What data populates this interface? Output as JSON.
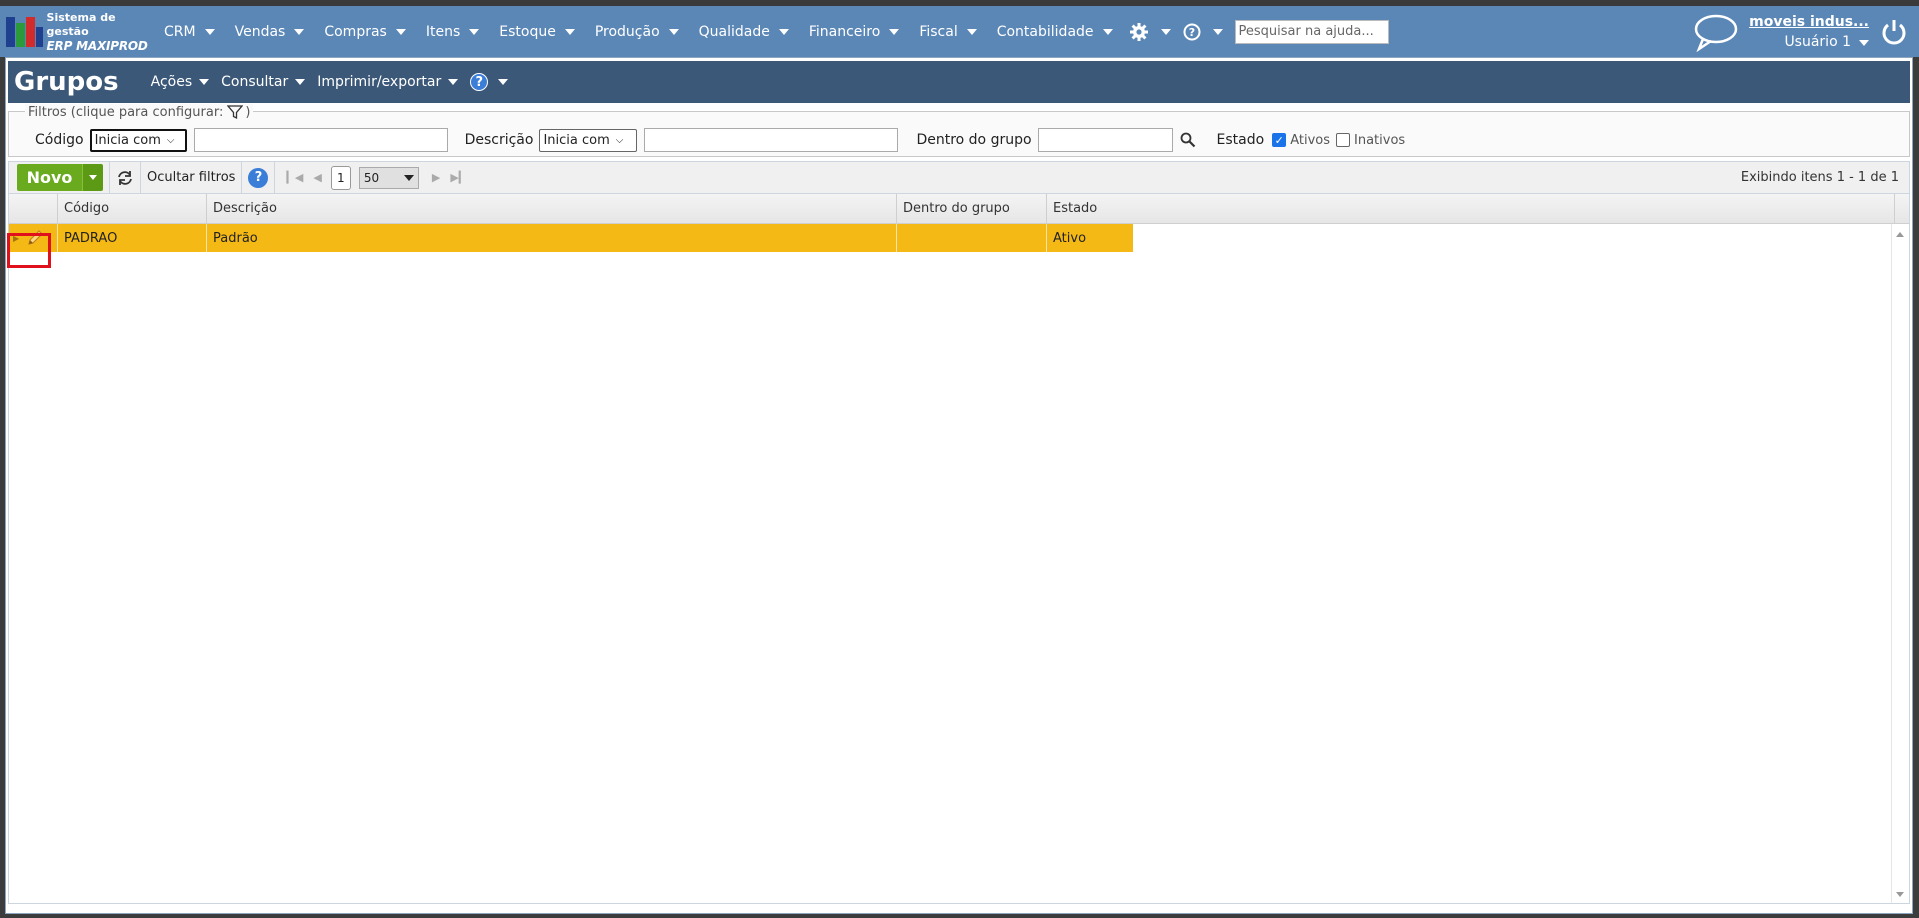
{
  "app": {
    "logo_line1": "Sistema de gestão",
    "logo_line2": "ERP MAXIPROD",
    "accent": "#5b87b7"
  },
  "nav": {
    "items": [
      {
        "label": "CRM"
      },
      {
        "label": "Vendas"
      },
      {
        "label": "Compras"
      },
      {
        "label": "Itens"
      },
      {
        "label": "Estoque"
      },
      {
        "label": "Produção"
      },
      {
        "label": "Qualidade"
      },
      {
        "label": "Financeiro"
      },
      {
        "label": "Fiscal"
      },
      {
        "label": "Contabilidade"
      }
    ],
    "help_search_placeholder": "Pesquisar na ajuda...",
    "company": "moveis indus...",
    "user": "Usuário 1"
  },
  "page": {
    "title": "Grupos",
    "actions": [
      "Ações",
      "Consultar",
      "Imprimir/exportar"
    ]
  },
  "filters": {
    "legend": "Filtros (clique para configurar:",
    "legend_close": ")",
    "codigo_label": "Código",
    "codigo_mode": "Inicia com",
    "descricao_label": "Descrição",
    "descricao_mode": "Inicia com",
    "grupo_label": "Dentro do grupo",
    "estado_label": "Estado",
    "ativos_label": "Ativos",
    "ativos_checked": true,
    "inativos_label": "Inativos",
    "inativos_checked": false
  },
  "toolbar": {
    "novo_label": "Novo",
    "hide_filters_label": "Ocultar filtros",
    "current_page": "1",
    "per_page": "50",
    "display_info": "Exibindo itens 1 - 1 de 1"
  },
  "grid": {
    "columns": [
      "Código",
      "Descrição",
      "Dentro do grupo",
      "Estado"
    ],
    "rows": [
      {
        "codigo": "PADRAO",
        "descricao": "Padrão",
        "grupo": "",
        "estado": "Ativo"
      }
    ],
    "selected_row_color": "#f4b915",
    "highlight_color": "#e0101c"
  }
}
